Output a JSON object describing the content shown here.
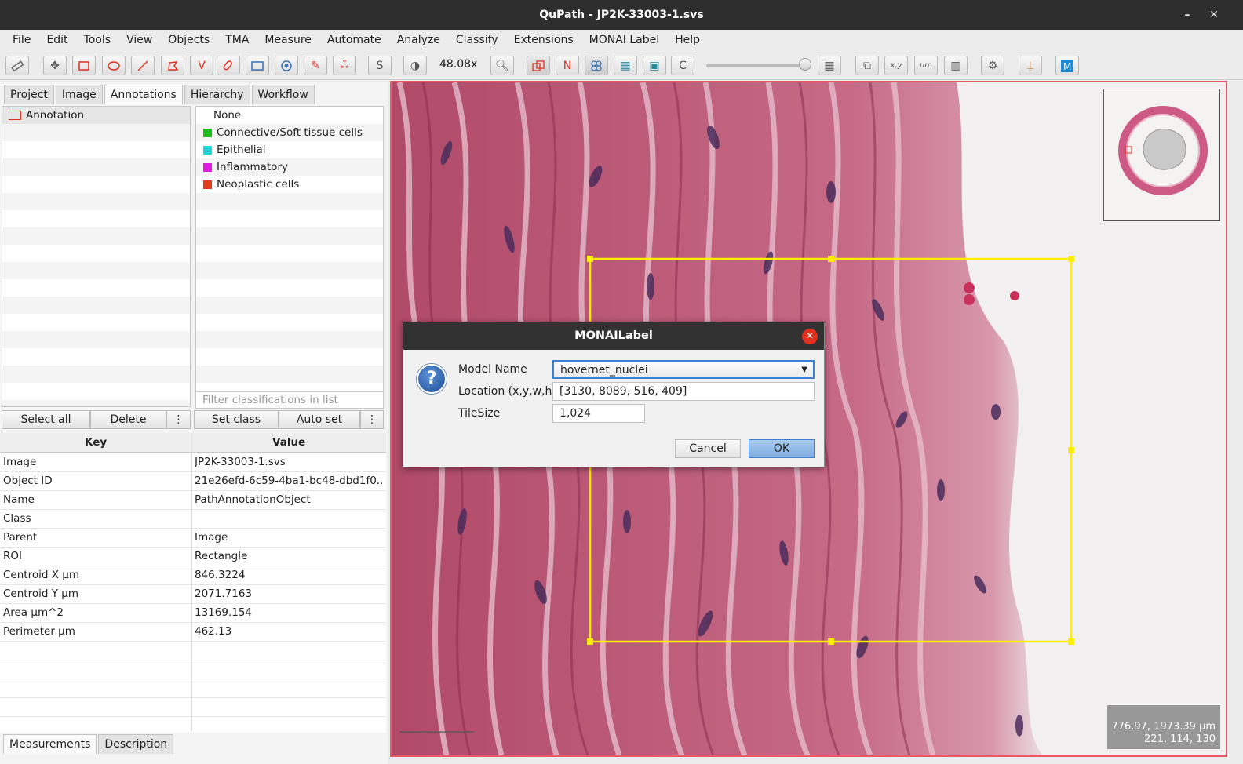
{
  "window": {
    "title": "QuPath - JP2K-33003-1.svs",
    "minimize": "–",
    "close": "✕"
  },
  "menu": [
    "File",
    "Edit",
    "Tools",
    "View",
    "Objects",
    "TMA",
    "Measure",
    "Automate",
    "Analyze",
    "Classify",
    "Extensions",
    "MONAI Label",
    "Help"
  ],
  "toolbar": {
    "zoom": "48.08x",
    "s_label": "S",
    "n_label": "N",
    "c_label": "C",
    "xy_label": "x,y",
    "um_label": "μm"
  },
  "left_tabs": [
    "Project",
    "Image",
    "Annotations",
    "Hierarchy",
    "Workflow"
  ],
  "annotation_list": {
    "items": [
      {
        "label": "Annotation",
        "color": "#e03020"
      }
    ]
  },
  "classes": [
    {
      "label": "None",
      "color": ""
    },
    {
      "label": "Connective/Soft tissue cells",
      "color": "#19c019"
    },
    {
      "label": "Epithelial",
      "color": "#21d6d6"
    },
    {
      "label": "Inflammatory",
      "color": "#e21de2"
    },
    {
      "label": "Neoplastic cells",
      "color": "#e63a1c"
    }
  ],
  "filter_placeholder": "Filter classifications in list",
  "buttons": {
    "select_all": "Select all",
    "delete": "Delete",
    "more": "⋮",
    "set_class": "Set class",
    "auto_set": "Auto set"
  },
  "properties": {
    "key_header": "Key",
    "value_header": "Value",
    "rows": [
      {
        "key": "Image",
        "value": "JP2K-33003-1.svs"
      },
      {
        "key": "Object ID",
        "value": "21e26efd-6c59-4ba1-bc48-dbd1f0..."
      },
      {
        "key": "Name",
        "value": "PathAnnotationObject"
      },
      {
        "key": "Class",
        "value": ""
      },
      {
        "key": "Parent",
        "value": "Image"
      },
      {
        "key": "ROI",
        "value": "Rectangle"
      },
      {
        "key": "Centroid X µm",
        "value": "846.3224"
      },
      {
        "key": "Centroid Y µm",
        "value": "2071.7163"
      },
      {
        "key": "Area µm^2",
        "value": "13169.154"
      },
      {
        "key": "Perimeter µm",
        "value": "462.13"
      }
    ]
  },
  "bottom_tabs": [
    "Measurements",
    "Description"
  ],
  "viewer": {
    "coords_line1": "776.97, 1973.39 µm",
    "coords_line2": "221, 114, 130",
    "selection_color": "#ffee00"
  },
  "dialog": {
    "title": "MONAILabel",
    "icon": "?",
    "close": "✕",
    "model_name_label": "Model Name",
    "model_name_value": "hovernet_nuclei",
    "location_label": "Location (x,y,w,h)",
    "location_value": "[3130, 8089, 516, 409]",
    "tilesize_label": "TileSize",
    "tilesize_value": "1,024",
    "cancel": "Cancel",
    "ok": "OK"
  }
}
